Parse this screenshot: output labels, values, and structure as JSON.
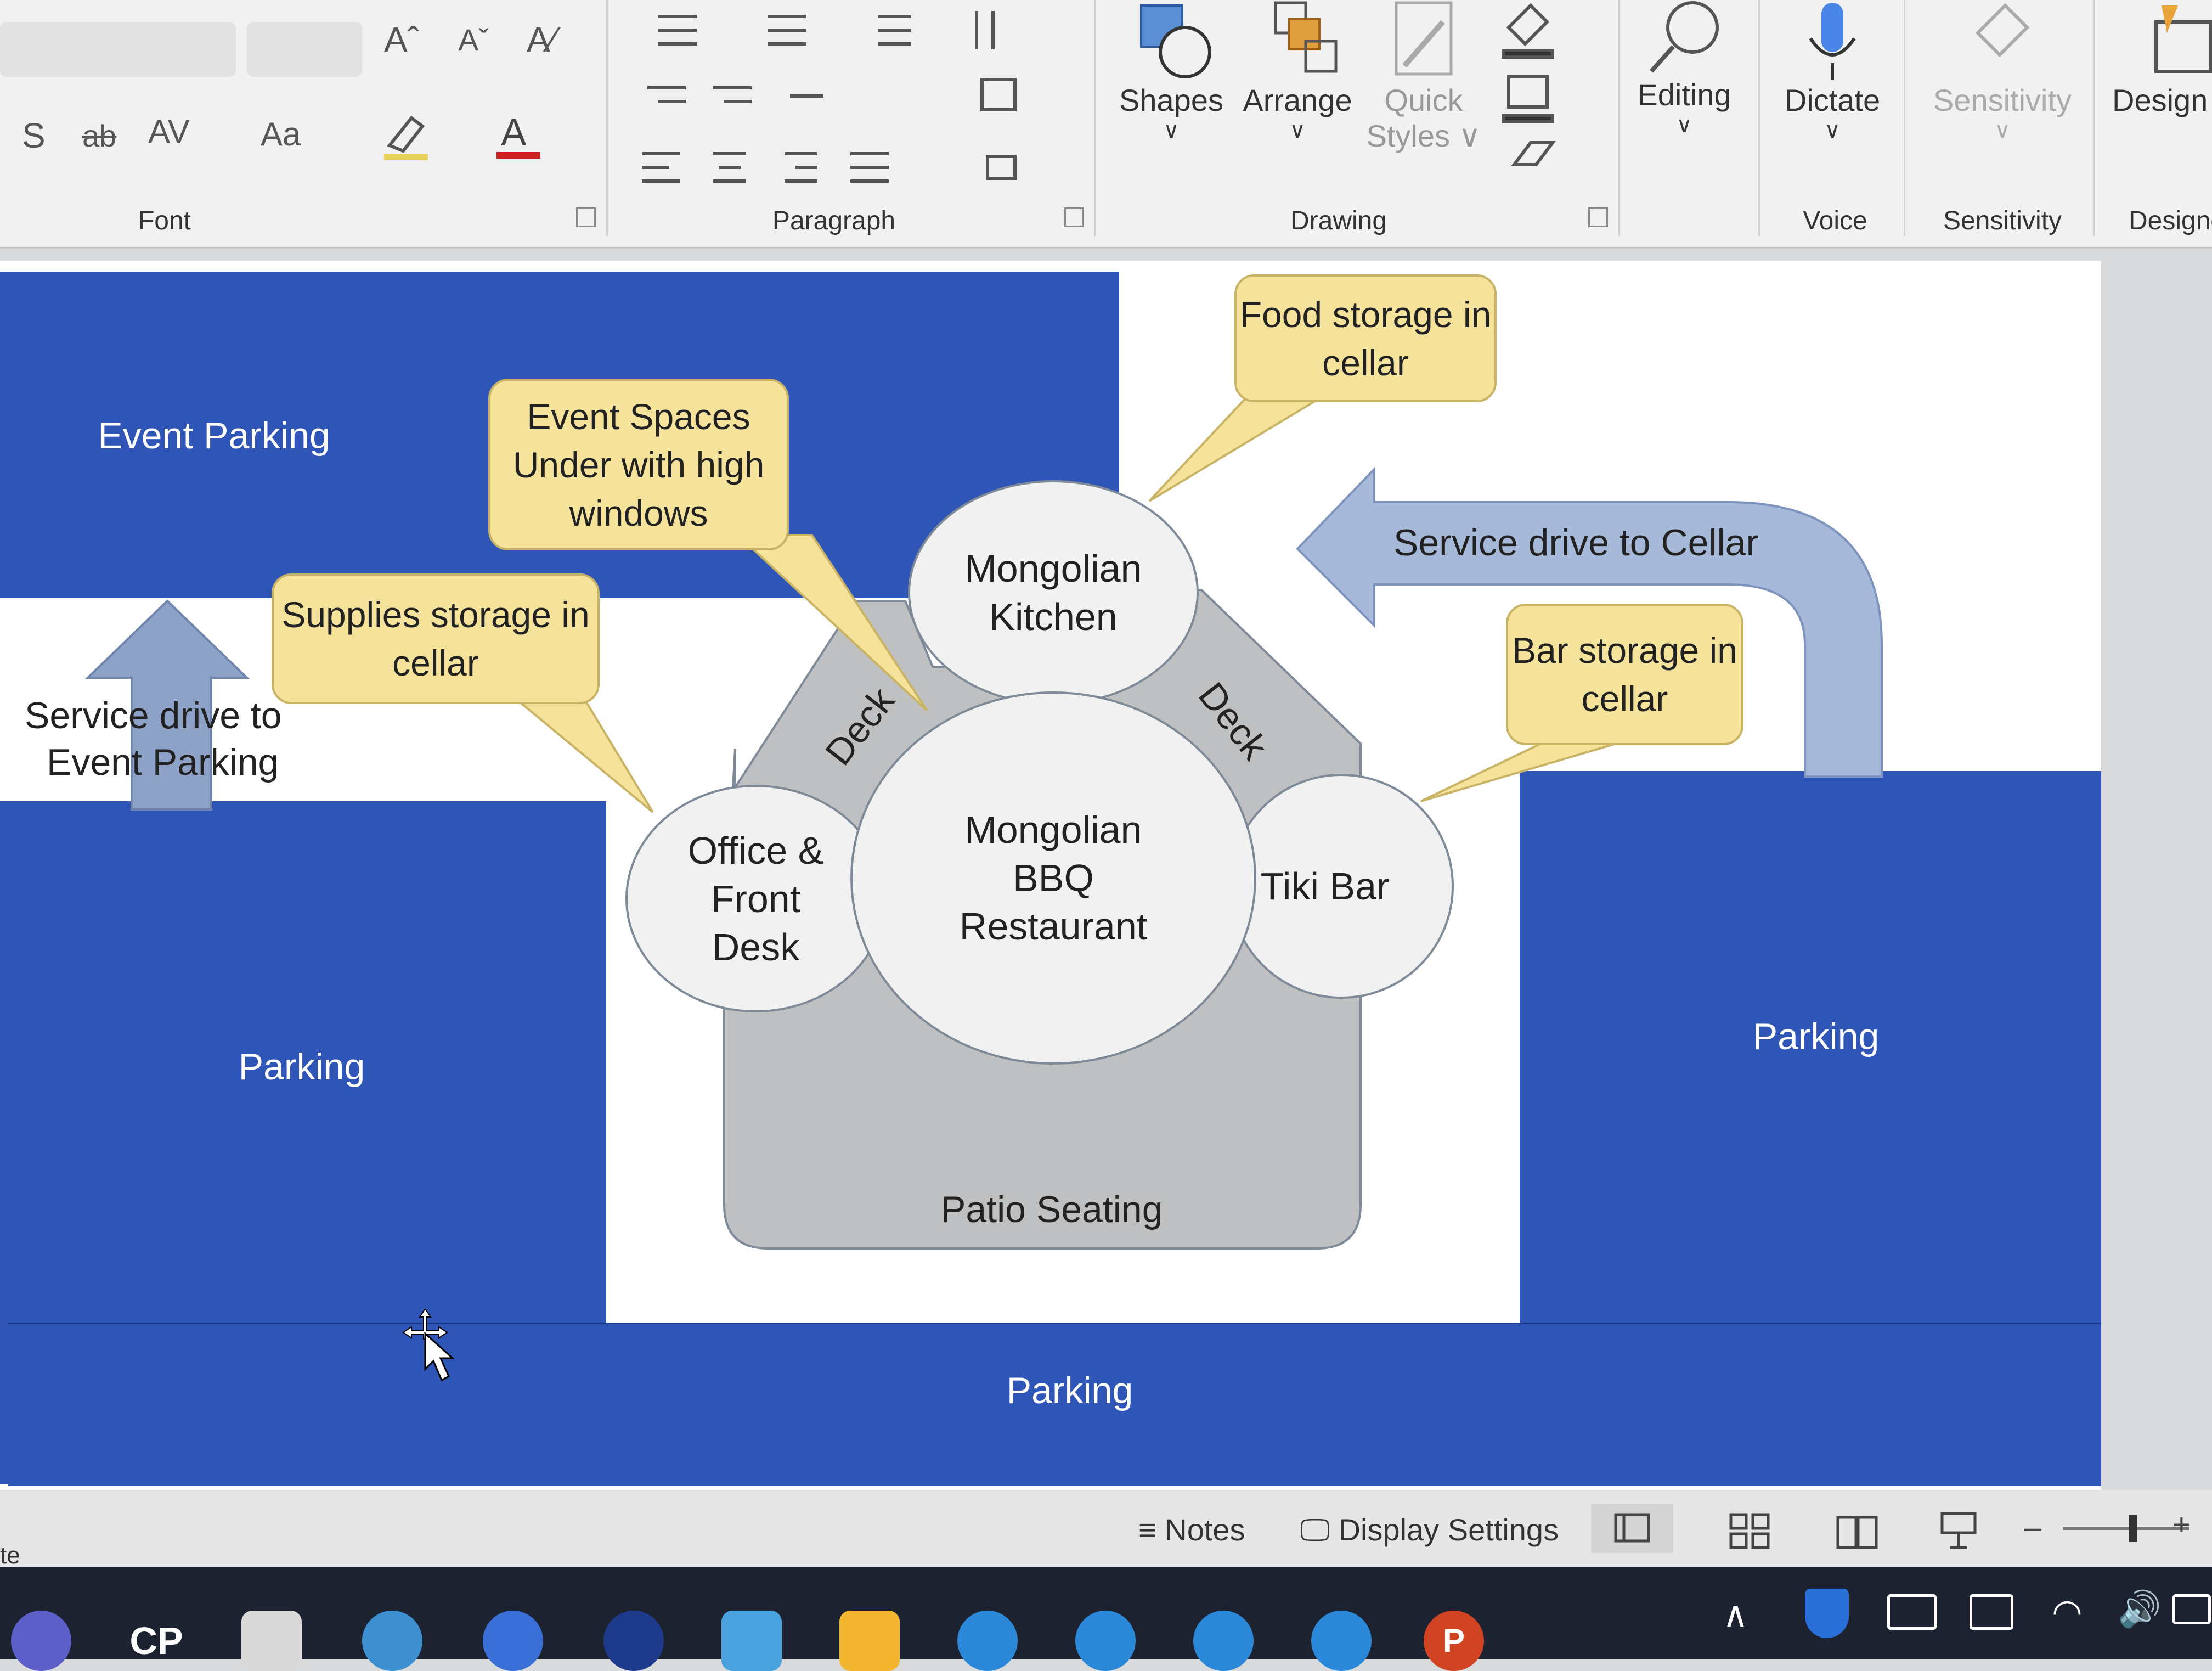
{
  "ribbon": {
    "groups": {
      "font": "Font",
      "paragraph": "Paragraph",
      "drawing": "Drawing",
      "voice": "Voice",
      "sensitivity": "Sensitivity",
      "designer": "Designe"
    },
    "buttons": {
      "shapes": "Shapes",
      "arrange": "Arrange",
      "quick_styles_line1": "Quick",
      "quick_styles_line2": "Styles",
      "editing": "Editing",
      "dictate": "Dictate",
      "sensitivity": "Sensitivity",
      "designer": "Design"
    },
    "font_glyphs": {
      "grow": "Aˆ",
      "shrink": "Aˇ",
      "shadow": "S",
      "strike": "ab",
      "spacing": "AV",
      "case": "Aa"
    }
  },
  "slide": {
    "event_parking": "Event Parking",
    "callout_event_spaces": "Event Spaces Under with high windows",
    "callout_food_storage": "Food storage in cellar",
    "callout_supplies_storage": "Supplies storage in cellar",
    "callout_bar_storage": "Bar storage in cellar",
    "service_drive_cellar": "Service drive to Cellar",
    "service_drive_event_line1": "Service drive to",
    "service_drive_event_line2": "Event Parking",
    "mongolian_kitchen": "Mongolian Kitchen",
    "restaurant": "Mongolian BBQ Restaurant",
    "office": "Office & Front Desk",
    "tiki_bar": "Tiki Bar",
    "deck_left": "Deck",
    "deck_right": "Deck",
    "patio": "Patio Seating",
    "parking_left": "Parking",
    "parking_right": "Parking",
    "parking_bottom": "Parking",
    "colors": {
      "parking_blue": "#2f56b7",
      "callout_yellow": "#f5e29b",
      "arrow_blue": "#a7b9d9",
      "deck_gray": "#bfc0c1"
    }
  },
  "statusbar": {
    "left_fragment": "te",
    "notes": "Notes",
    "display_settings": "Display Settings"
  },
  "taskbar": {
    "cp_label": "CP",
    "powerpoint_letter": "P"
  }
}
